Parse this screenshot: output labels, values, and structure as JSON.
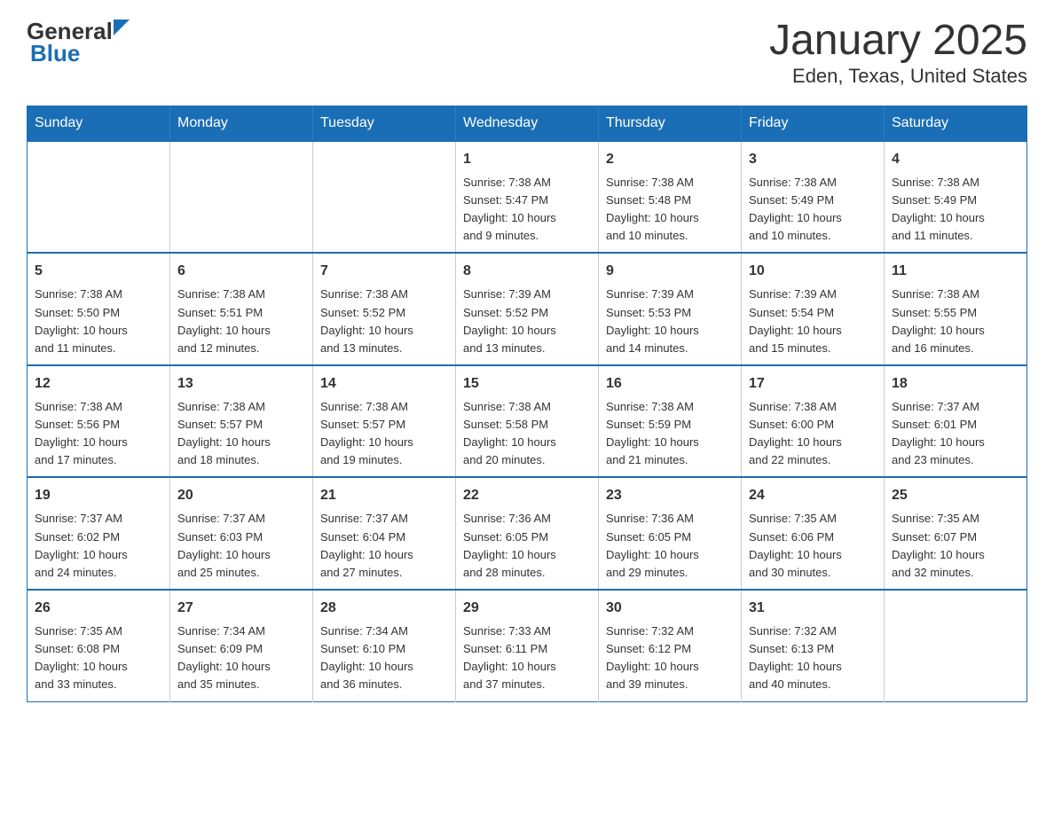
{
  "logo": {
    "general": "General",
    "blue": "Blue",
    "triangle_color": "#1a6eb5"
  },
  "title": "January 2025",
  "subtitle": "Eden, Texas, United States",
  "header_days": [
    "Sunday",
    "Monday",
    "Tuesday",
    "Wednesday",
    "Thursday",
    "Friday",
    "Saturday"
  ],
  "weeks": [
    [
      {
        "day": "",
        "info": ""
      },
      {
        "day": "",
        "info": ""
      },
      {
        "day": "",
        "info": ""
      },
      {
        "day": "1",
        "info": "Sunrise: 7:38 AM\nSunset: 5:47 PM\nDaylight: 10 hours\nand 9 minutes."
      },
      {
        "day": "2",
        "info": "Sunrise: 7:38 AM\nSunset: 5:48 PM\nDaylight: 10 hours\nand 10 minutes."
      },
      {
        "day": "3",
        "info": "Sunrise: 7:38 AM\nSunset: 5:49 PM\nDaylight: 10 hours\nand 10 minutes."
      },
      {
        "day": "4",
        "info": "Sunrise: 7:38 AM\nSunset: 5:49 PM\nDaylight: 10 hours\nand 11 minutes."
      }
    ],
    [
      {
        "day": "5",
        "info": "Sunrise: 7:38 AM\nSunset: 5:50 PM\nDaylight: 10 hours\nand 11 minutes."
      },
      {
        "day": "6",
        "info": "Sunrise: 7:38 AM\nSunset: 5:51 PM\nDaylight: 10 hours\nand 12 minutes."
      },
      {
        "day": "7",
        "info": "Sunrise: 7:38 AM\nSunset: 5:52 PM\nDaylight: 10 hours\nand 13 minutes."
      },
      {
        "day": "8",
        "info": "Sunrise: 7:39 AM\nSunset: 5:52 PM\nDaylight: 10 hours\nand 13 minutes."
      },
      {
        "day": "9",
        "info": "Sunrise: 7:39 AM\nSunset: 5:53 PM\nDaylight: 10 hours\nand 14 minutes."
      },
      {
        "day": "10",
        "info": "Sunrise: 7:39 AM\nSunset: 5:54 PM\nDaylight: 10 hours\nand 15 minutes."
      },
      {
        "day": "11",
        "info": "Sunrise: 7:38 AM\nSunset: 5:55 PM\nDaylight: 10 hours\nand 16 minutes."
      }
    ],
    [
      {
        "day": "12",
        "info": "Sunrise: 7:38 AM\nSunset: 5:56 PM\nDaylight: 10 hours\nand 17 minutes."
      },
      {
        "day": "13",
        "info": "Sunrise: 7:38 AM\nSunset: 5:57 PM\nDaylight: 10 hours\nand 18 minutes."
      },
      {
        "day": "14",
        "info": "Sunrise: 7:38 AM\nSunset: 5:57 PM\nDaylight: 10 hours\nand 19 minutes."
      },
      {
        "day": "15",
        "info": "Sunrise: 7:38 AM\nSunset: 5:58 PM\nDaylight: 10 hours\nand 20 minutes."
      },
      {
        "day": "16",
        "info": "Sunrise: 7:38 AM\nSunset: 5:59 PM\nDaylight: 10 hours\nand 21 minutes."
      },
      {
        "day": "17",
        "info": "Sunrise: 7:38 AM\nSunset: 6:00 PM\nDaylight: 10 hours\nand 22 minutes."
      },
      {
        "day": "18",
        "info": "Sunrise: 7:37 AM\nSunset: 6:01 PM\nDaylight: 10 hours\nand 23 minutes."
      }
    ],
    [
      {
        "day": "19",
        "info": "Sunrise: 7:37 AM\nSunset: 6:02 PM\nDaylight: 10 hours\nand 24 minutes."
      },
      {
        "day": "20",
        "info": "Sunrise: 7:37 AM\nSunset: 6:03 PM\nDaylight: 10 hours\nand 25 minutes."
      },
      {
        "day": "21",
        "info": "Sunrise: 7:37 AM\nSunset: 6:04 PM\nDaylight: 10 hours\nand 27 minutes."
      },
      {
        "day": "22",
        "info": "Sunrise: 7:36 AM\nSunset: 6:05 PM\nDaylight: 10 hours\nand 28 minutes."
      },
      {
        "day": "23",
        "info": "Sunrise: 7:36 AM\nSunset: 6:05 PM\nDaylight: 10 hours\nand 29 minutes."
      },
      {
        "day": "24",
        "info": "Sunrise: 7:35 AM\nSunset: 6:06 PM\nDaylight: 10 hours\nand 30 minutes."
      },
      {
        "day": "25",
        "info": "Sunrise: 7:35 AM\nSunset: 6:07 PM\nDaylight: 10 hours\nand 32 minutes."
      }
    ],
    [
      {
        "day": "26",
        "info": "Sunrise: 7:35 AM\nSunset: 6:08 PM\nDaylight: 10 hours\nand 33 minutes."
      },
      {
        "day": "27",
        "info": "Sunrise: 7:34 AM\nSunset: 6:09 PM\nDaylight: 10 hours\nand 35 minutes."
      },
      {
        "day": "28",
        "info": "Sunrise: 7:34 AM\nSunset: 6:10 PM\nDaylight: 10 hours\nand 36 minutes."
      },
      {
        "day": "29",
        "info": "Sunrise: 7:33 AM\nSunset: 6:11 PM\nDaylight: 10 hours\nand 37 minutes."
      },
      {
        "day": "30",
        "info": "Sunrise: 7:32 AM\nSunset: 6:12 PM\nDaylight: 10 hours\nand 39 minutes."
      },
      {
        "day": "31",
        "info": "Sunrise: 7:32 AM\nSunset: 6:13 PM\nDaylight: 10 hours\nand 40 minutes."
      },
      {
        "day": "",
        "info": ""
      }
    ]
  ]
}
